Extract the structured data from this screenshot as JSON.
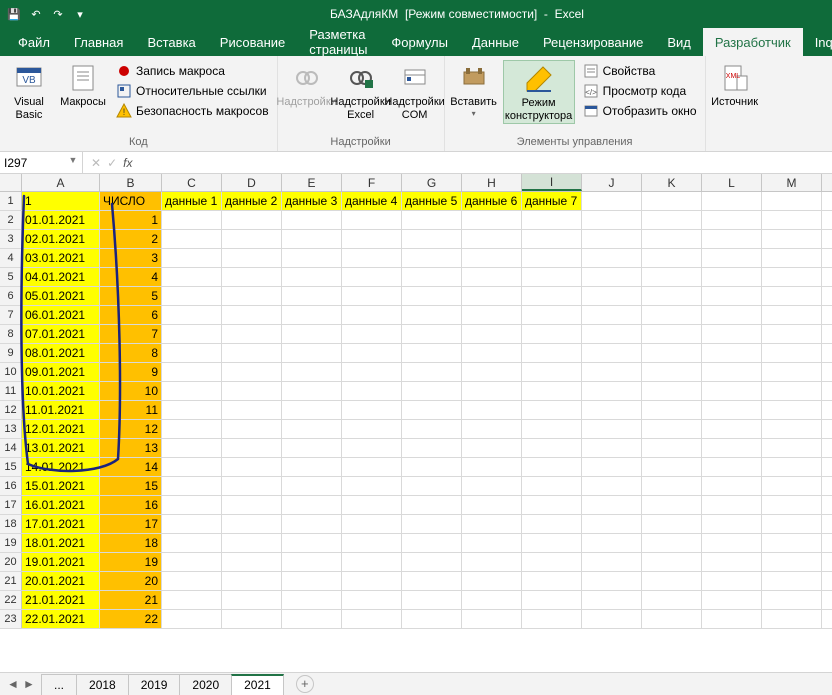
{
  "titlebar": {
    "doc_name": "БАЗАдляКМ",
    "mode": "[Режим совместимости]",
    "app": "Excel"
  },
  "tabs": {
    "file": "Файл",
    "home": "Главная",
    "insert": "Вставка",
    "draw": "Рисование",
    "pagelayout": "Разметка страницы",
    "formulas": "Формулы",
    "data": "Данные",
    "review": "Рецензирование",
    "view": "Вид",
    "developer": "Разработчик",
    "inqu": "Inqu"
  },
  "ribbon": {
    "vb": "Visual\nBasic",
    "macros": "Макросы",
    "recmacro": "Запись макроса",
    "relrefs": "Относительные ссылки",
    "macrosec": "Безопасность макросов",
    "grp_code": "Код",
    "addins": "Надстройки",
    "excel_addins": "Надстройки\nExcel",
    "com_addins": "Надстройки\nCOM",
    "grp_addins": "Надстройки",
    "insert_ctrl": "Вставить",
    "design_mode": "Режим\nконструктора",
    "props": "Свойства",
    "viewcode": "Просмотр кода",
    "showdlg": "Отобразить окно",
    "grp_controls": "Элементы управления",
    "source": "Источник"
  },
  "namebox": "I297",
  "columns": [
    "A",
    "B",
    "C",
    "D",
    "E",
    "F",
    "G",
    "H",
    "I",
    "J",
    "K",
    "L",
    "M"
  ],
  "header_row": {
    "A": "1",
    "B": "ЧИСЛО",
    "C": "данные 1",
    "D": "данные 2",
    "E": "данные 3",
    "F": "данные 4",
    "G": "данные 5",
    "H": "данные 6",
    "I": "данные 7"
  },
  "data_rows": [
    {
      "n": "2",
      "date": "01.01.2021",
      "num": "1"
    },
    {
      "n": "3",
      "date": "02.01.2021",
      "num": "2"
    },
    {
      "n": "4",
      "date": "03.01.2021",
      "num": "3"
    },
    {
      "n": "5",
      "date": "04.01.2021",
      "num": "4"
    },
    {
      "n": "6",
      "date": "05.01.2021",
      "num": "5"
    },
    {
      "n": "7",
      "date": "06.01.2021",
      "num": "6"
    },
    {
      "n": "8",
      "date": "07.01.2021",
      "num": "7"
    },
    {
      "n": "9",
      "date": "08.01.2021",
      "num": "8"
    },
    {
      "n": "10",
      "date": "09.01.2021",
      "num": "9"
    },
    {
      "n": "11",
      "date": "10.01.2021",
      "num": "10"
    },
    {
      "n": "12",
      "date": "11.01.2021",
      "num": "11"
    },
    {
      "n": "13",
      "date": "12.01.2021",
      "num": "12"
    },
    {
      "n": "14",
      "date": "13.01.2021",
      "num": "13"
    },
    {
      "n": "15",
      "date": "14.01.2021",
      "num": "14"
    },
    {
      "n": "16",
      "date": "15.01.2021",
      "num": "15"
    },
    {
      "n": "17",
      "date": "16.01.2021",
      "num": "16"
    },
    {
      "n": "18",
      "date": "17.01.2021",
      "num": "17"
    },
    {
      "n": "19",
      "date": "18.01.2021",
      "num": "18"
    },
    {
      "n": "20",
      "date": "19.01.2021",
      "num": "19"
    },
    {
      "n": "21",
      "date": "20.01.2021",
      "num": "20"
    },
    {
      "n": "22",
      "date": "21.01.2021",
      "num": "21"
    },
    {
      "n": "23",
      "date": "22.01.2021",
      "num": "22"
    }
  ],
  "sheets": {
    "dots": "...",
    "s2018": "2018",
    "s2019": "2019",
    "s2020": "2020",
    "s2021": "2021"
  }
}
